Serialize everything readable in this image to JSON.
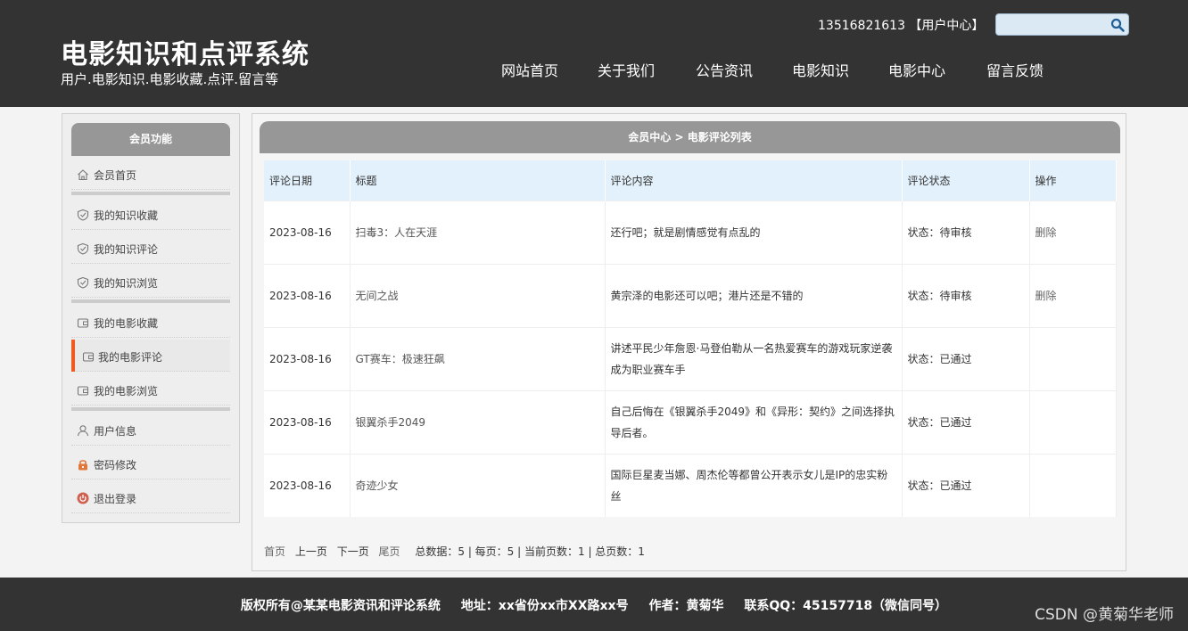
{
  "header": {
    "site_title": "电影知识和点评系统",
    "site_subtitle": "用户.电影知识.电影收藏.点评.留言等",
    "user_center": "13516821613 【用户中心】",
    "search_placeholder": ""
  },
  "nav": [
    {
      "label": "网站首页"
    },
    {
      "label": "关于我们"
    },
    {
      "label": "公告资讯"
    },
    {
      "label": "电影知识"
    },
    {
      "label": "电影中心"
    },
    {
      "label": "留言反馈"
    }
  ],
  "sidebar": {
    "title": "会员功能",
    "items": [
      {
        "label": "会员首页",
        "icon": "home-icon"
      },
      {
        "label": "我的知识收藏",
        "icon": "shield-icon"
      },
      {
        "label": "我的知识评论",
        "icon": "shield-icon"
      },
      {
        "label": "我的知识浏览",
        "icon": "shield-icon"
      },
      {
        "label": "我的电影收藏",
        "icon": "wallet-icon"
      },
      {
        "label": "我的电影评论",
        "icon": "wallet-icon"
      },
      {
        "label": "我的电影浏览",
        "icon": "wallet-icon"
      },
      {
        "label": "用户信息",
        "icon": "user-icon"
      },
      {
        "label": "密码修改",
        "icon": "lock-icon"
      },
      {
        "label": "退出登录",
        "icon": "power-icon"
      }
    ],
    "active_item": "我的电影评论"
  },
  "main": {
    "breadcrumb": "会员中心 > 电影评论列表",
    "columns": [
      "评论日期",
      "标题",
      "评论内容",
      "评论状态",
      "操作"
    ],
    "rows": [
      {
        "date": "2023-08-16",
        "title": "扫毒3：人在天涯",
        "content": "还行吧；就是剧情感觉有点乱的",
        "status": "状态：待审核",
        "op": "删除"
      },
      {
        "date": "2023-08-16",
        "title": "无间之战",
        "content": "黄宗泽的电影还可以吧；港片还是不错的",
        "status": "状态：待审核",
        "op": "删除"
      },
      {
        "date": "2023-08-16",
        "title": "GT赛车：极速狂飙",
        "content": "讲述平民少年詹恩·马登伯勒从一名热爱赛车的游戏玩家逆袭成为职业赛车手",
        "status": "状态：已通过",
        "op": ""
      },
      {
        "date": "2023-08-16",
        "title": "银翼杀手2049",
        "content": "自己后悔在《银翼杀手2049》和《异形：契约》之间选择执导后者。",
        "status": "状态：已通过",
        "op": ""
      },
      {
        "date": "2023-08-16",
        "title": "奇迹少女",
        "content": "国际巨星麦当娜、周杰伦等都曾公开表示女儿是IP的忠实粉丝",
        "status": "状态：已通过",
        "op": ""
      }
    ],
    "pager": {
      "first": "首页",
      "prev": "上一页",
      "next": "下一页",
      "last": "尾页",
      "summary": "总数据：5 | 每页：5 | 当前页数：1 | 总页数：1"
    }
  },
  "footer": {
    "copyright": "版权所有@某某电影资讯和评论系统",
    "address": "地址：xx省份xx市XX路xx号",
    "author": "作者：黄菊华",
    "contact": "联系QQ：45157718（微信同号）",
    "watermark": "CSDN @黄菊华老师"
  }
}
